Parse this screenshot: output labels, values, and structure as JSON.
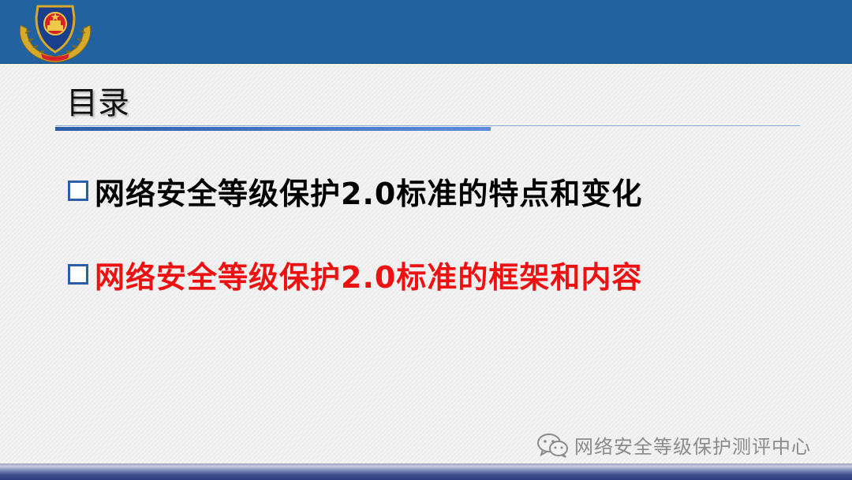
{
  "header": {
    "logo_icon": "police-emblem-icon",
    "bar_color": "#2262a0"
  },
  "title": "目录",
  "items": [
    {
      "label": "网络安全等级保护2.0标准的特点和变化",
      "color": "#000000",
      "icon": "checkbox-square-icon"
    },
    {
      "label": "网络安全等级保护2.0标准的框架和内容",
      "color": "#ee1111",
      "icon": "checkbox-square-icon"
    }
  ],
  "watermark": {
    "icon": "wechat-icon",
    "text": "网络安全等级保护测评中心"
  }
}
